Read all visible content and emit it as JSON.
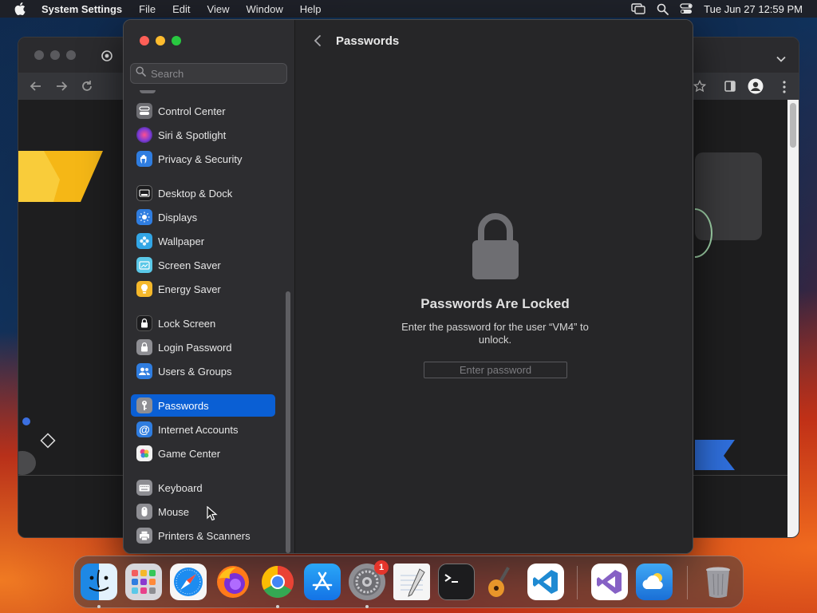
{
  "menubar": {
    "app_name": "System Settings",
    "menus": [
      "File",
      "Edit",
      "View",
      "Window",
      "Help"
    ],
    "clock": "Tue Jun 27  12:59 PM"
  },
  "settings": {
    "search_placeholder": "Search",
    "sidebar_items": [
      {
        "label": "Control Center",
        "icon": "control-center-icon",
        "color": "#6e6e73"
      },
      {
        "label": "Siri & Spotlight",
        "icon": "siri-icon",
        "color": "#8a3bd0"
      },
      {
        "label": "Privacy & Security",
        "icon": "hand-icon",
        "color": "#2f7de0"
      },
      {
        "label": "Desktop & Dock",
        "icon": "dock-icon",
        "color": "#1c1c1e"
      },
      {
        "label": "Displays",
        "icon": "sun-icon",
        "color": "#2f7de0"
      },
      {
        "label": "Wallpaper",
        "icon": "flower-icon",
        "color": "#32a6e6"
      },
      {
        "label": "Screen Saver",
        "icon": "screen-saver-icon",
        "color": "#5ac8e8"
      },
      {
        "label": "Energy Saver",
        "icon": "bulb-icon",
        "color": "#f5b82a"
      },
      {
        "label": "Lock Screen",
        "icon": "lock-screen-icon",
        "color": "#1c1c1e"
      },
      {
        "label": "Login Password",
        "icon": "padlock-icon",
        "color": "#8e8e93"
      },
      {
        "label": "Users & Groups",
        "icon": "users-icon",
        "color": "#2f7de0"
      },
      {
        "label": "Passwords",
        "icon": "key-icon",
        "color": "#8e8e93",
        "selected": true
      },
      {
        "label": "Internet Accounts",
        "icon": "at-icon",
        "color": "#2f7de0"
      },
      {
        "label": "Game Center",
        "icon": "game-center-icon",
        "color": "#e8e8e8"
      },
      {
        "label": "Keyboard",
        "icon": "keyboard-icon",
        "color": "#8e8e93"
      },
      {
        "label": "Mouse",
        "icon": "mouse-icon",
        "color": "#8e8e93"
      },
      {
        "label": "Printers & Scanners",
        "icon": "printer-icon",
        "color": "#8e8e93"
      }
    ],
    "main": {
      "title": "Passwords",
      "locked_title": "Passwords Are Locked",
      "locked_message": "Enter the password for the user “VM4” to unlock.",
      "password_placeholder": "Enter password"
    }
  },
  "dock": {
    "apps": [
      "Finder",
      "Launchpad",
      "Safari",
      "Firefox",
      "Chrome",
      "App Store",
      "System Settings",
      "TextEdit",
      "Terminal",
      "GarageBand",
      "VS Code",
      "Visual Studio",
      "Weather",
      "Trash"
    ],
    "settings_badge": "1"
  }
}
